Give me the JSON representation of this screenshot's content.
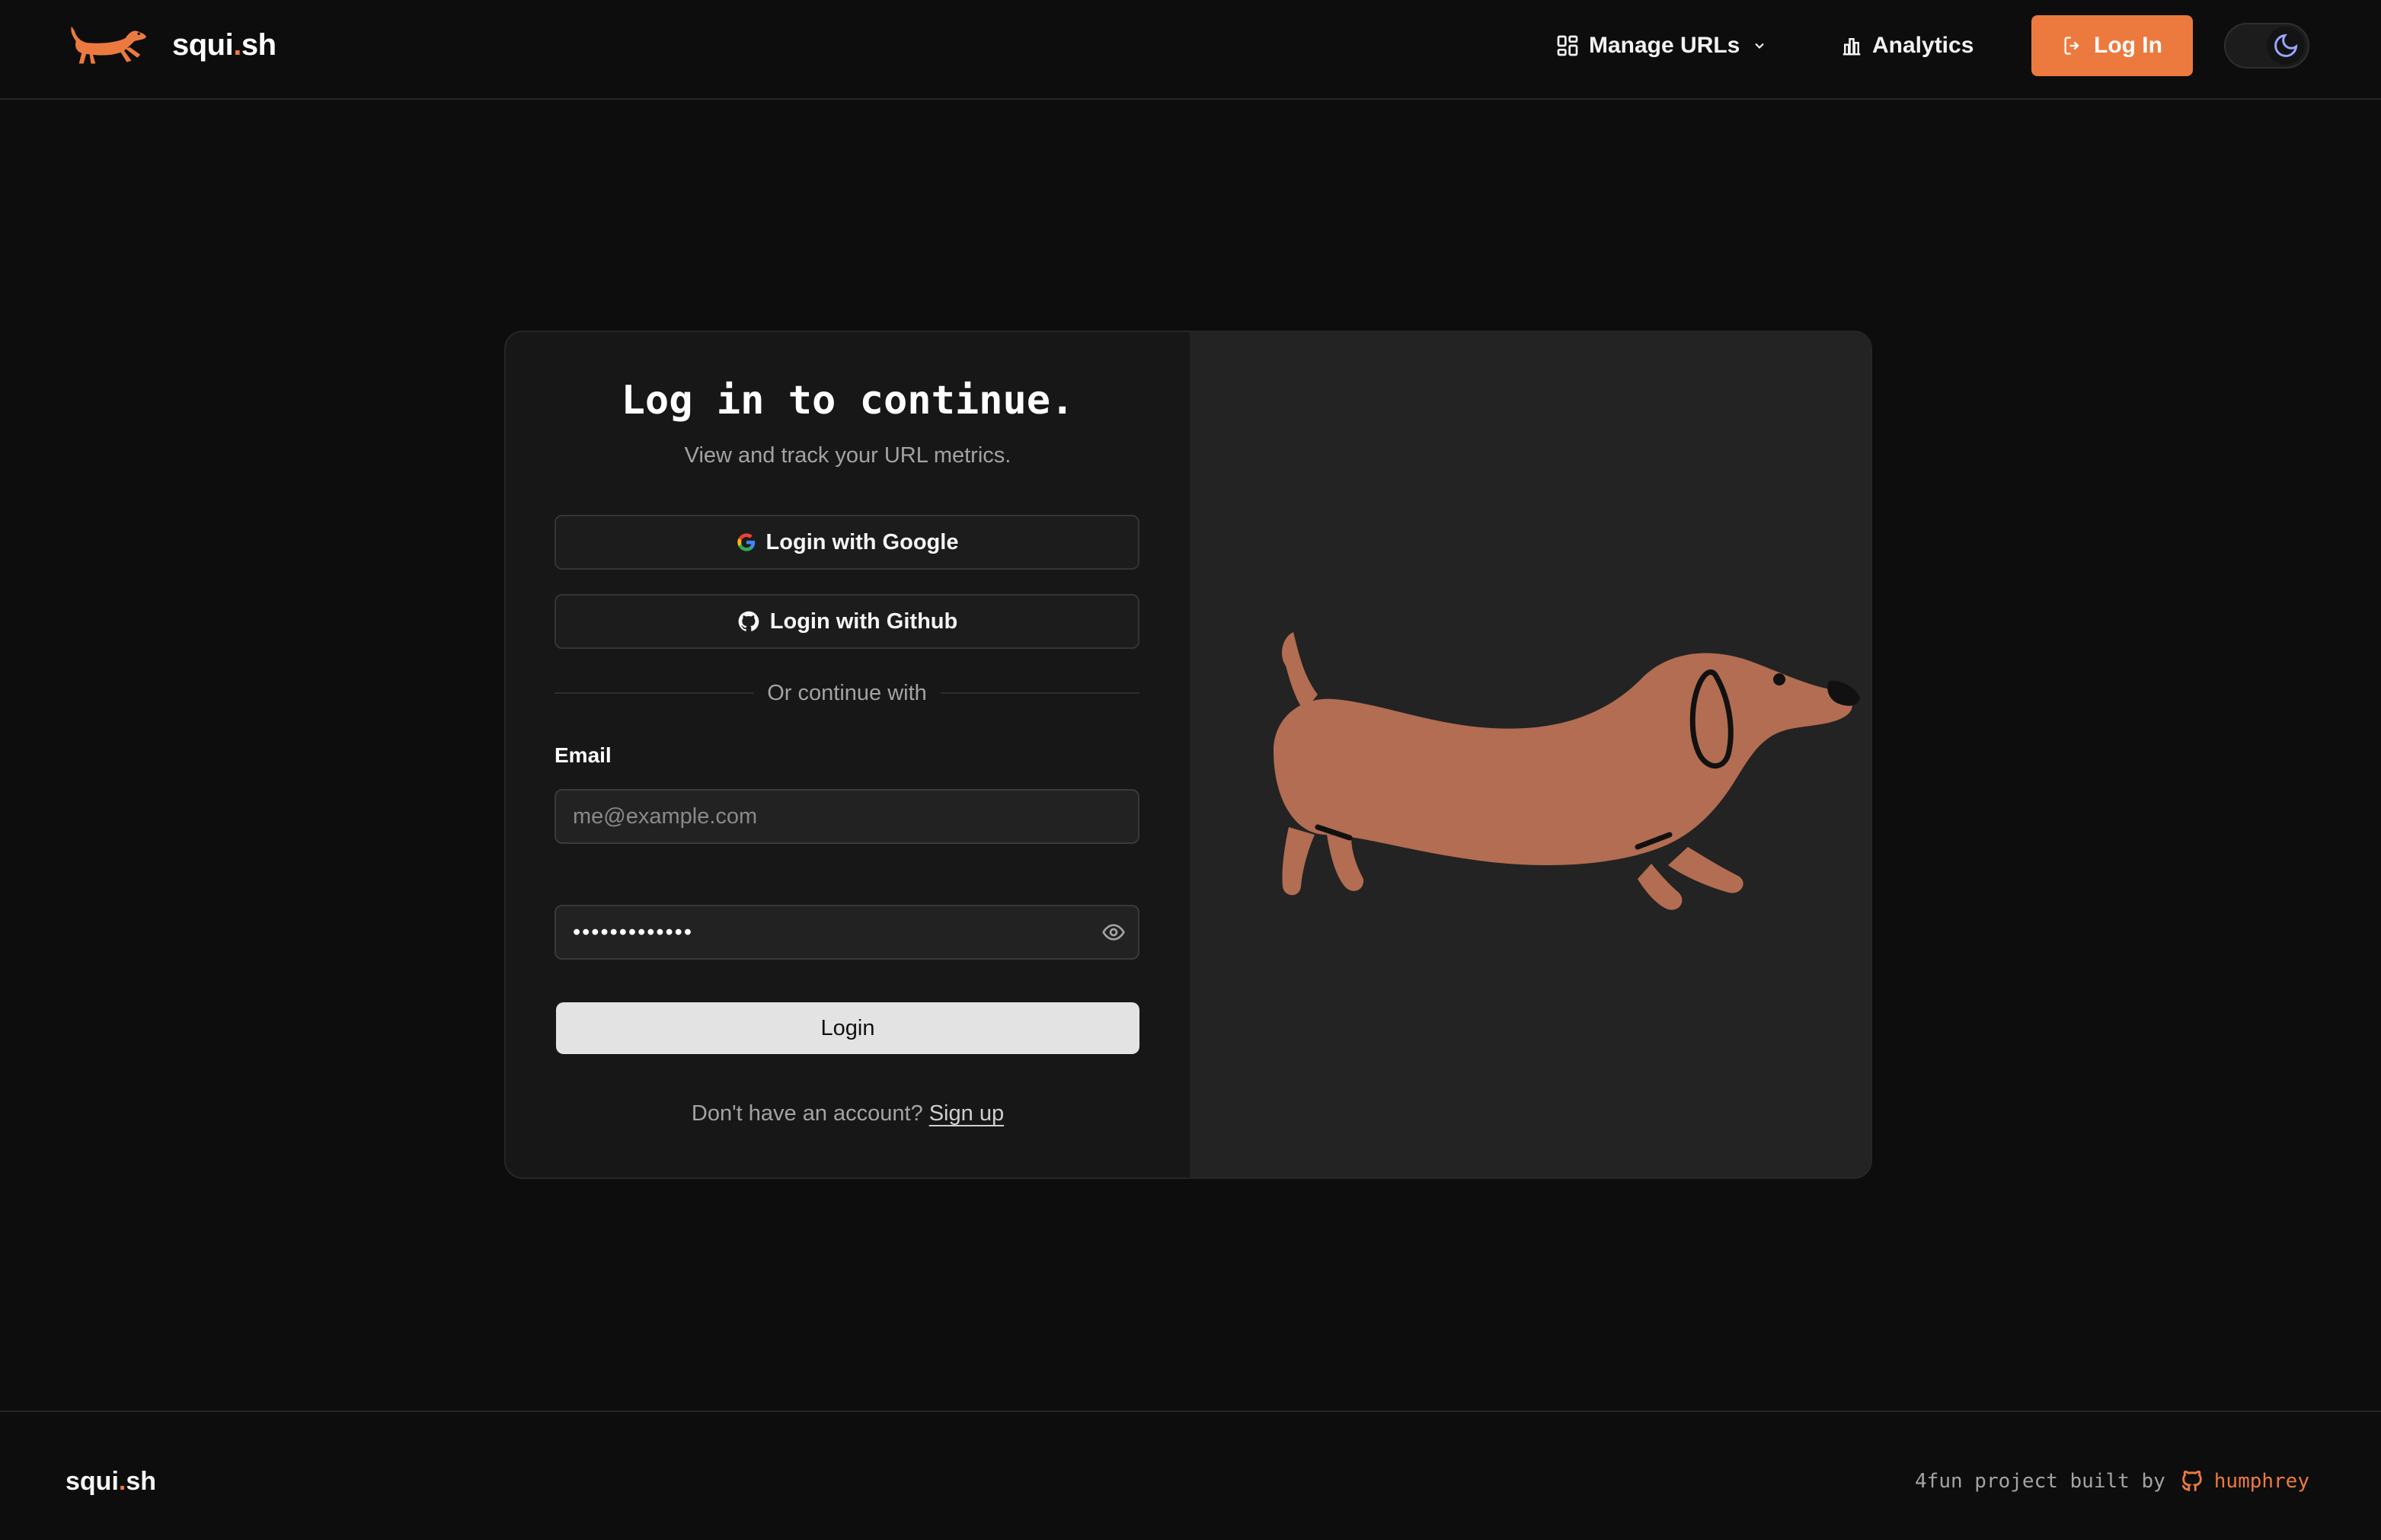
{
  "header": {
    "brand_name_main": "squi",
    "brand_name_dot": ".",
    "brand_name_tail": "sh",
    "nav": {
      "manage_urls": "Manage URLs",
      "analytics": "Analytics",
      "login": "Log In"
    }
  },
  "login_card": {
    "title": "Log in to continue.",
    "subtitle": "View and track your URL metrics.",
    "google_label": "Login with Google",
    "github_label": "Login with Github",
    "divider_text": "Or continue with",
    "email_label": "Email",
    "email_placeholder": "me@example.com",
    "password_value": "•••••••••••••",
    "submit_label": "Login",
    "signup_prompt": "Don't have an account?",
    "signup_link": "Sign up"
  },
  "footer": {
    "brand_main": "squi",
    "brand_dot": ".",
    "brand_tail": "sh",
    "credit_text": "4fun project built by",
    "author": "humphrey"
  },
  "icons": {
    "brand": "dachshund-logo-icon",
    "manage_urls": "grid-dashboard-icon",
    "dropdown": "chevron-down-icon",
    "analytics": "bar-chart-icon",
    "login": "log-in-icon",
    "theme": "moon-icon",
    "google": "google-icon",
    "github": "github-icon",
    "password_toggle": "eye-icon",
    "illustration": "dachshund-illustration"
  },
  "colors": {
    "accent": "#ec7a3f",
    "background": "#0d0d0d",
    "card": "#171717",
    "dog": "#b26d52"
  }
}
